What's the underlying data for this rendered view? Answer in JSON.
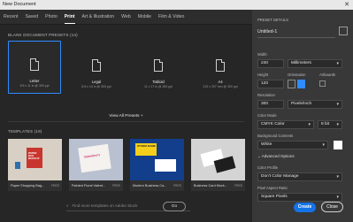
{
  "window": {
    "title": "New Document",
    "close_icon": "close-icon"
  },
  "tabs": [
    "Recent",
    "Saved",
    "Photo",
    "Print",
    "Art & Illustration",
    "Web",
    "Mobile",
    "Film & Video"
  ],
  "presets_section": {
    "heading": "BLANK DOCUMENT PRESETS  (14)",
    "items": [
      {
        "name": "Letter",
        "size": "8.5 x 11 in @ 300 ppi"
      },
      {
        "name": "Legal",
        "size": "8.5 x 14 in @ 300 ppi"
      },
      {
        "name": "Tabloid",
        "size": "11 x 17 in @ 300 ppi"
      },
      {
        "name": "A4",
        "size": "210 x 297 mm @ 300 ppi"
      }
    ],
    "view_all": "View All Presets +"
  },
  "templates_section": {
    "heading": "TEMPLATES  (19)",
    "items": [
      {
        "title": "Paper Shopping Bag...",
        "badge": "FREE",
        "thumb_text": "PAPER BAG MOCKUP"
      },
      {
        "title": "Painted Floral Valent...",
        "badge": "FREE",
        "thumb_text": "Valentine's"
      },
      {
        "title": "Modern Business Ca...",
        "badge": "FREE",
        "thumb_text": "STUDIO NAME"
      },
      {
        "title": "Business Card Mock...",
        "badge": "FREE",
        "thumb_text": ""
      }
    ]
  },
  "search": {
    "placeholder": "Find more templates on Adobe Stock",
    "go_label": "Go"
  },
  "details": {
    "heading": "PRESET DETAILS",
    "name": "Untitled-1",
    "width_label": "Width",
    "width_value": "240",
    "width_unit": "Millimeters",
    "height_label": "Height",
    "height_value": "120",
    "orientation_label": "Orientation",
    "artboards_label": "Artboards",
    "resolution_label": "Resolution",
    "resolution_value": "300",
    "resolution_unit": "Pixels/Inch",
    "color_mode_label": "Color Mode",
    "color_mode_value": "CMYK Color",
    "bit_depth": "8 bit",
    "background_label": "Background Contents",
    "background_value": "White",
    "advanced_label": "Advanced Options",
    "color_profile_label": "Color Profile",
    "color_profile_value": "Don't Color Manage",
    "pixel_aspect_label": "Pixel Aspect Ratio",
    "pixel_aspect_value": "Square Pixels"
  },
  "actions": {
    "create": "Create",
    "close": "Close"
  },
  "colors": {
    "accent": "#1473e6",
    "selection": "#2f8bff"
  }
}
